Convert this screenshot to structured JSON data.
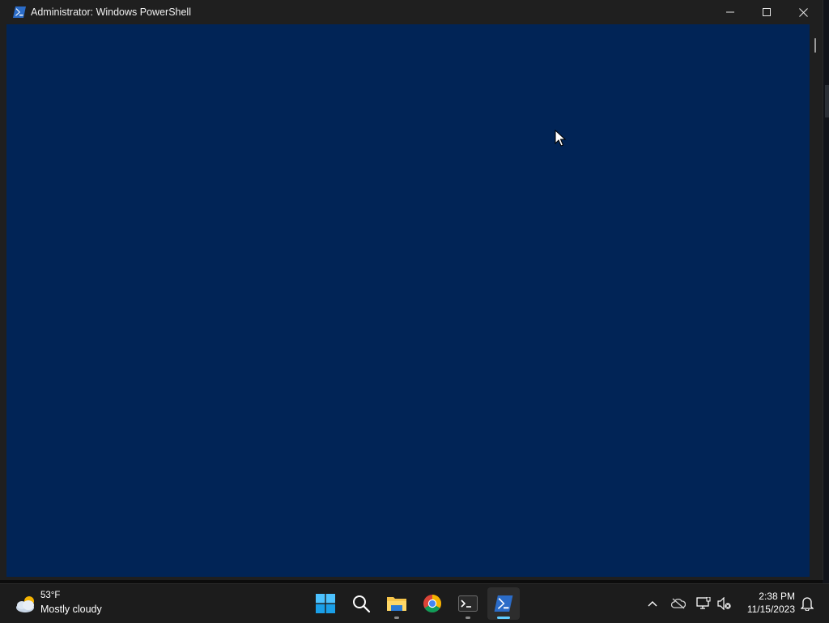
{
  "window": {
    "title": "Administrator: Windows PowerShell",
    "icon": "powershell-icon",
    "controls": {
      "minimize": "minimize-icon",
      "maximize": "maximize-icon",
      "close": "close-icon"
    },
    "console_background": "#012456"
  },
  "taskbar": {
    "weather": {
      "temperature": "53°F",
      "condition": "Mostly cloudy",
      "icon": "partly-cloudy-icon"
    },
    "apps": [
      {
        "name": "Start",
        "icon": "windows-start-icon",
        "running": false,
        "active": false
      },
      {
        "name": "Search",
        "icon": "search-icon",
        "running": false,
        "active": false
      },
      {
        "name": "File Explorer",
        "icon": "folder-icon",
        "running": true,
        "active": false
      },
      {
        "name": "Google Chrome",
        "icon": "chrome-icon",
        "running": false,
        "active": false
      },
      {
        "name": "Terminal",
        "icon": "terminal-icon",
        "running": true,
        "active": false
      },
      {
        "name": "Windows PowerShell",
        "icon": "powershell-icon",
        "running": true,
        "active": true
      }
    ],
    "tray": {
      "icons": [
        "chevron-up-icon",
        "onedrive-offline-icon",
        "network-icon",
        "volume-muted-icon",
        "notification-bell-icon"
      ]
    },
    "clock": {
      "time": "2:38 PM",
      "date": "11/15/2023"
    }
  },
  "colors": {
    "accent": "#60cdff",
    "console_bg": "#012456",
    "titlebar_bg": "#1f1f1f",
    "taskbar_bg": "#1c1c1c"
  }
}
